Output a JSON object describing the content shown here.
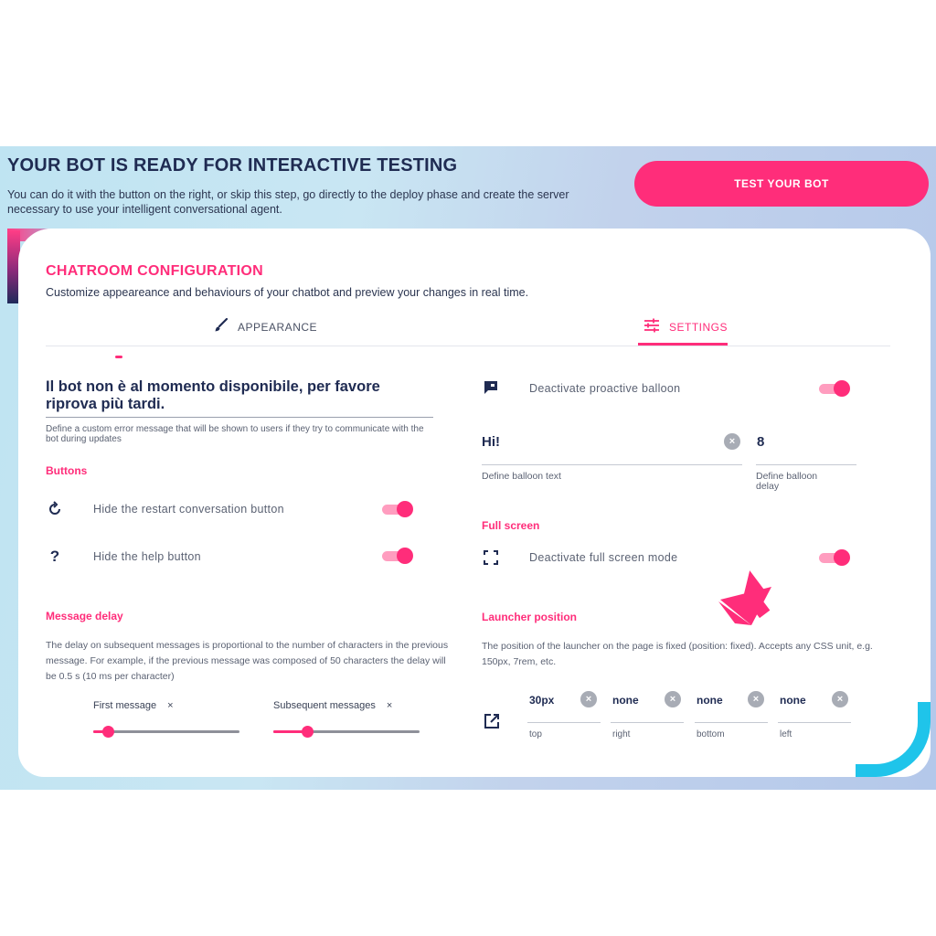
{
  "hero": {
    "title": "YOUR BOT IS READY FOR INTERACTIVE TESTING",
    "description": "You can do it with the button on the right, or skip this step, go directly to the deploy phase and create the server necessary to use your intelligent conversational agent.",
    "test_button": "TEST YOUR BOT"
  },
  "config": {
    "title": "CHATROOM CONFIGURATION",
    "description": "Customize appeareance and behaviours of your chatbot and preview your changes in real time.",
    "tabs": [
      {
        "label": "APPEARANCE",
        "icon": "brush-icon",
        "active": false
      },
      {
        "label": "SETTINGS",
        "icon": "sliders-icon",
        "active": true
      }
    ]
  },
  "left": {
    "error_message": "Il bot non è al momento disponibile, per favore riprova più tardi.",
    "error_hint": "Define a custom error message that will be shown to users if they try to communicate with the bot during updates",
    "buttons_label": "Buttons",
    "restart_label": "Hide the restart conversation button",
    "restart_on": true,
    "help_icon_glyph": "?",
    "help_label": "Hide the help button",
    "help_on": true,
    "delay_label": "Message delay",
    "delay_desc": "The delay on subsequent messages is proportional to the number of characters in the previous message. For example, if the previous message was composed of 50 characters the delay will be 0.5 s (10 ms per character)",
    "first_message_label": "First message",
    "subsequent_label": "Subsequent messages",
    "clear_glyph": "×",
    "first_message_level": 0.1,
    "subsequent_level": 0.23
  },
  "right": {
    "balloon_label": "Deactivate proactive balloon",
    "balloon_on": true,
    "balloon_text": "Hi!",
    "balloon_text_hint": "Define balloon text",
    "balloon_delay": "8",
    "balloon_delay_hint": "Define balloon delay",
    "fullscreen_label": "Full screen",
    "fullscreen_row": "Deactivate full screen mode",
    "fullscreen_on": true,
    "launcher_label": "Launcher position",
    "launcher_desc": "The position of the launcher on the page is fixed (position: fixed). Accepts any CSS unit, e.g. 150px, 7rem, etc.",
    "positions": [
      {
        "value": "30px",
        "hint": "top"
      },
      {
        "value": "none",
        "hint": "right"
      },
      {
        "value": "none",
        "hint": "bottom"
      },
      {
        "value": "none",
        "hint": "left"
      }
    ],
    "clear_glyph": "×"
  },
  "colors": {
    "accent": "#ff2d7a",
    "navy": "#1f2b52",
    "cyan": "#1fc4ea"
  }
}
